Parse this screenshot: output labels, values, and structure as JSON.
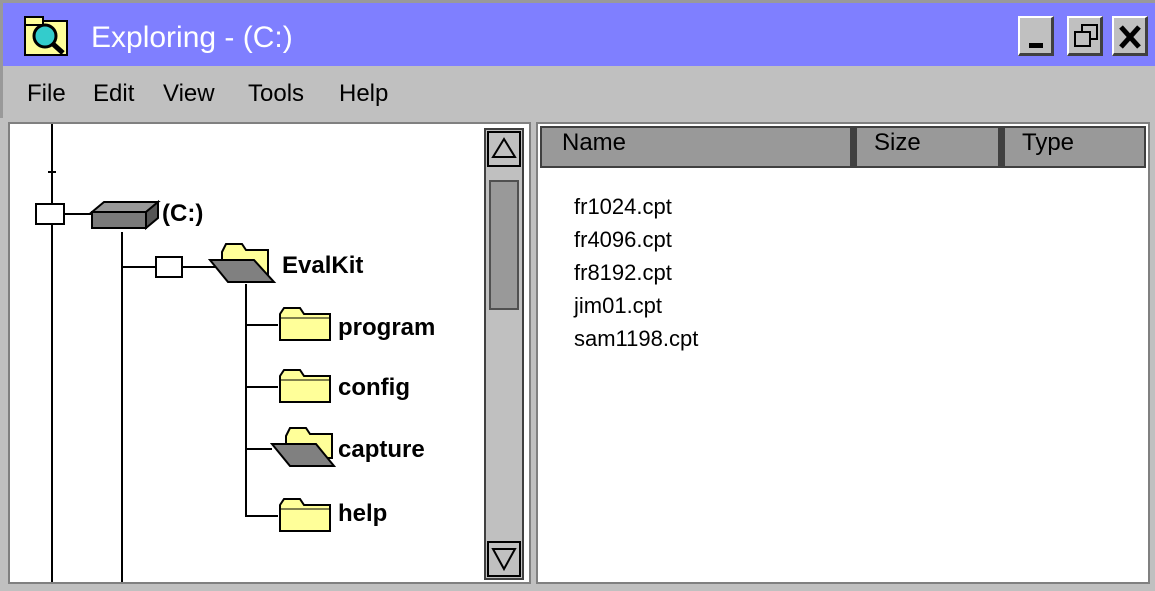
{
  "window": {
    "title": "Exploring - (C:)"
  },
  "menu": [
    "File",
    "Edit",
    "View",
    "Tools",
    "Help"
  ],
  "tree": {
    "drive": "(C:)",
    "root_folder": "EvalKit",
    "subfolders": [
      "program",
      "config",
      "capture",
      "help"
    ]
  },
  "list": {
    "columns": [
      "Name",
      "Size",
      "Type"
    ],
    "files": [
      "fr1024.cpt",
      "fr4096.cpt",
      "fr8192.cpt",
      "jim01.cpt",
      "sam1198.cpt"
    ]
  },
  "icons": {
    "app": "explorer-magnifier-icon",
    "drive": "drive-icon",
    "folder_closed": "folder-icon",
    "folder_open": "open-folder-icon"
  },
  "colors": {
    "titlebar": "#7f7fff",
    "chrome": "#c0c0c0",
    "folder": "#ffff99"
  }
}
